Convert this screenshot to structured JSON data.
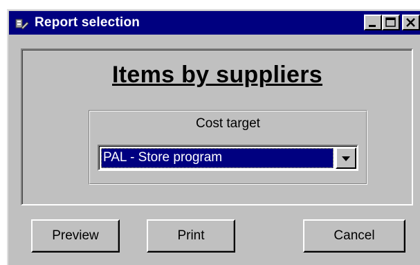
{
  "window": {
    "title": "Report selection",
    "icon": "report-app-icon",
    "controls": {
      "minimize": "minimize-icon",
      "maximize": "maximize-icon",
      "close": "close-icon"
    }
  },
  "report": {
    "title": "Items by suppliers"
  },
  "cost_target": {
    "label": "Cost target",
    "selected": "PAL - Store program",
    "dropdown_icon": "dropdown-arrow-icon"
  },
  "buttons": {
    "preview": "Preview",
    "print": "Print",
    "cancel": "Cancel"
  },
  "colors": {
    "titlebar": "#000080",
    "face": "#c0c0c0",
    "selection": "#000080"
  }
}
